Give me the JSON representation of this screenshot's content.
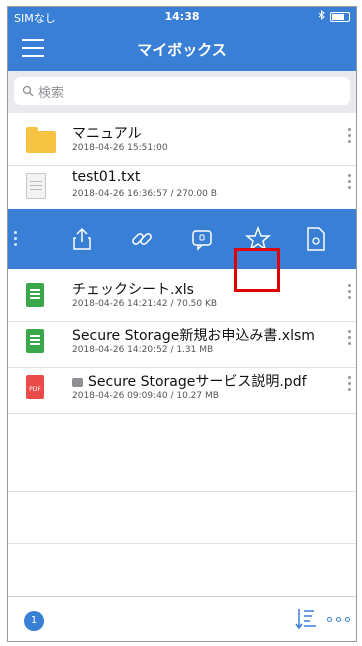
{
  "status_bar": {
    "carrier": "SIMなし",
    "time": "14:38"
  },
  "nav": {
    "title": "マイボックス"
  },
  "search": {
    "placeholder": "検索"
  },
  "files": [
    {
      "name": "マニュアル",
      "meta": "2018-04-26 15:51:00",
      "icon": "folder-icon"
    },
    {
      "name": "test01.txt",
      "meta": "2018-04-26 16:36:57 / 270.00 B",
      "icon": "text-file-icon"
    },
    {
      "name": "チェックシート.xls",
      "meta": "2018-04-26 14:21:42 / 70.50 KB",
      "icon": "excel-file-icon"
    },
    {
      "name": "Secure Storage新規お申込み書.xlsm",
      "meta": "2018-04-26 14:20:52 / 1.31 MB",
      "icon": "excel-file-icon"
    },
    {
      "name": "Secure Storageサービス説明.pdf",
      "meta": "2018-04-26 09:09:40 / 10.27 MB",
      "icon": "pdf-file-icon",
      "pdf_label": "PDF"
    }
  ],
  "action_bar": [
    "share-icon",
    "link-icon",
    "comment-icon",
    "star-icon",
    "file-settings-icon"
  ],
  "bottom": {
    "badge_count": "1"
  },
  "colors": {
    "accent": "#3a7fd6",
    "highlight": "#e00000"
  }
}
